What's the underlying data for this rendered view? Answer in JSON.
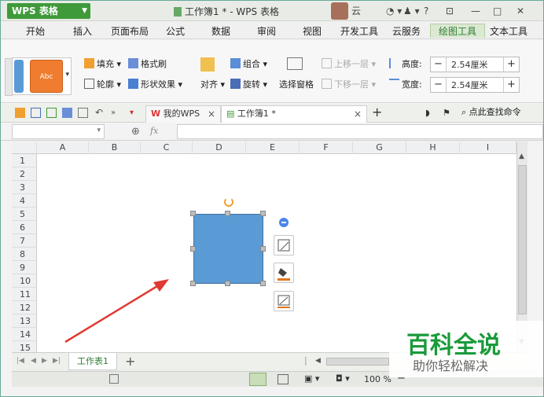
{
  "titlebar": {
    "app": "WPS 表格",
    "title": "工作簿1 * - WPS 表格",
    "user": "云",
    "controls": [
      "?",
      "—",
      "□",
      "✕"
    ]
  },
  "menu": [
    "开始",
    "插入",
    "页面布局",
    "公式",
    "数据",
    "审阅",
    "视图",
    "开发工具",
    "云服务",
    "绘图工具",
    "文本工具"
  ],
  "menu_active_index": 9,
  "ribbon": {
    "style_sample": "Abc",
    "fill": "填充",
    "format_painter": "格式刷",
    "outline": "轮廓",
    "shape_effects": "形状效果",
    "align": "对齐",
    "group": "组合",
    "rotate": "旋转",
    "selection_pane": "选择窗格",
    "bring_forward": "上移一层",
    "send_backward": "下移一层",
    "height_label": "高度:",
    "height_value": "2.54厘米",
    "width_label": "宽度:",
    "width_value": "2.54厘米"
  },
  "doctabs": {
    "tab1": "我的WPS",
    "tab2": "工作簿1 *",
    "search": "点此查找命令"
  },
  "formula": {
    "fx": "fx",
    "namebox": ""
  },
  "columns": [
    "A",
    "B",
    "C",
    "D",
    "E",
    "F",
    "G",
    "H",
    "I"
  ],
  "rows": [
    "1",
    "2",
    "3",
    "4",
    "5",
    "6",
    "7",
    "8",
    "9",
    "10",
    "11",
    "12",
    "13",
    "14",
    "15"
  ],
  "sheets": [
    "工作表1"
  ],
  "status": {
    "zoom": "100 %"
  },
  "watermark": {
    "title": "百科全说",
    "subtitle": "助你轻松解决"
  },
  "colors": {
    "accent": "#3f9a3a",
    "shape_fill": "#5b9bd5",
    "arrow": "#e03a32"
  }
}
